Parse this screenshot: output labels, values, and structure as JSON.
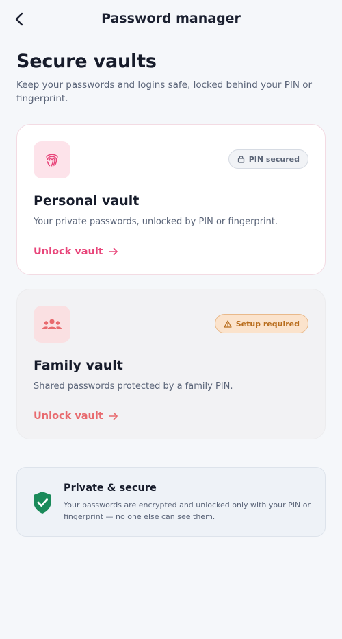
{
  "header": {
    "title": "Password manager",
    "back_icon": "chevron-left-icon"
  },
  "page": {
    "title": "Secure vaults",
    "subtitle": "Keep your passwords and logins safe, locked behind your PIN or fingerprint."
  },
  "vaults": [
    {
      "icon": "fingerprint-icon",
      "badge": "PIN secured",
      "badge_icon": "lock-icon",
      "title": "Personal vault",
      "description": "Your private passwords, unlocked by PIN or fingerprint.",
      "action": "Unlock vault",
      "accent": "#e8457a"
    },
    {
      "icon": "group-icon",
      "badge": "Setup required",
      "badge_icon": "warning-icon",
      "title": "Family vault",
      "description": "Shared passwords protected by a family PIN.",
      "action": "Unlock vault",
      "accent": "#e86a6e"
    }
  ],
  "info": {
    "icon": "shield-check-icon",
    "title": "Private & secure",
    "description": "Your passwords are encrypted and unlocked only with your PIN or fingerprint — no one else can see them.",
    "color": "#1a8a5a"
  }
}
